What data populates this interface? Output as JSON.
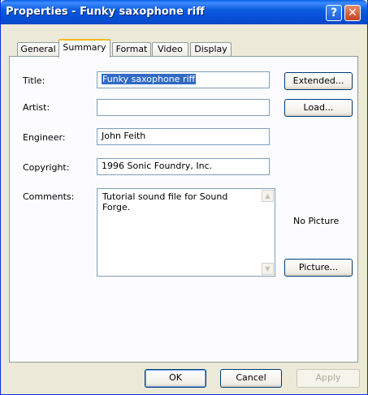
{
  "window": {
    "title": "Properties - Funky saxophone riff"
  },
  "titlebar": {
    "help_icon": "question-icon",
    "help_glyph": "?",
    "close_icon": "close-icon",
    "close_glyph": "✕"
  },
  "tabs": [
    {
      "label": "General",
      "active": false
    },
    {
      "label": "Summary",
      "active": true
    },
    {
      "label": "Format",
      "active": false
    },
    {
      "label": "Video",
      "active": false
    },
    {
      "label": "Display",
      "active": false
    }
  ],
  "form": {
    "title_label": "Title:",
    "title_value": "Funky saxophone riff",
    "artist_label": "Artist:",
    "artist_value": "",
    "engineer_label": "Engineer:",
    "engineer_value": "John Feith",
    "copyright_label": "Copyright:",
    "copyright_value": "1996 Sonic Foundry, Inc.",
    "comments_label": "Comments:",
    "comments_value": "Tutorial sound file for Sound Forge."
  },
  "side": {
    "extended_label": "Extended...",
    "load_label": "Load...",
    "no_picture_text": "No Picture",
    "picture_label": "Picture..."
  },
  "footer": {
    "ok_label": "OK",
    "cancel_label": "Cancel",
    "apply_label": "Apply"
  },
  "colors": {
    "titlebar": "#0a5fe8",
    "dialog_bg": "#ece9d8",
    "selection": "#316ac5",
    "tab_highlight": "#f9b81f"
  }
}
